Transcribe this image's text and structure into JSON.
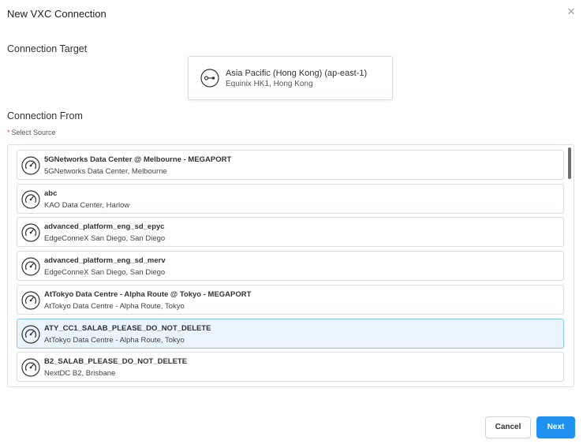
{
  "dialog": {
    "title": "New VXC Connection",
    "close_icon": "close-icon"
  },
  "target": {
    "section_label": "Connection Target",
    "name": "Asia Pacific (Hong Kong) (ap-east-1)",
    "location": "Equinix HK1, Hong Kong",
    "icon": "connection-endpoint-icon"
  },
  "source": {
    "section_label": "Connection From",
    "required_marker": "*",
    "required_label": "Select Source",
    "items": [
      {
        "name": "5GNetworks Data Center @ Melbourne - MEGAPORT",
        "location": "5GNetworks Data Center, Melbourne",
        "selected": false
      },
      {
        "name": "abc",
        "location": "KAO Data Center, Harlow",
        "selected": false
      },
      {
        "name": "advanced_platform_eng_sd_epyc",
        "location": "EdgeConneX San Diego, San Diego",
        "selected": false
      },
      {
        "name": "advanced_platform_eng_sd_merv",
        "location": "EdgeConneX San Diego, San Diego",
        "selected": false
      },
      {
        "name": "AtTokyo Data Centre - Alpha Route @ Tokyo - MEGAPORT",
        "location": "AtTokyo Data Centre - Alpha Route, Tokyo",
        "selected": false
      },
      {
        "name": "ATY_CC1_SALAB_PLEASE_DO_NOT_DELETE",
        "location": "AtTokyo Data Centre - Alpha Route, Tokyo",
        "selected": true
      },
      {
        "name": "B2_SALAB_PLEASE_DO_NOT_DELETE",
        "location": "NextDC B2, Brisbane",
        "selected": false
      }
    ],
    "item_icon": "router-icon",
    "selected_bg": "#e9f4fd",
    "selected_border": "#8cc3ee"
  },
  "footer": {
    "cancel_label": "Cancel",
    "next_label": "Next",
    "primary_color": "#1e90f0"
  }
}
